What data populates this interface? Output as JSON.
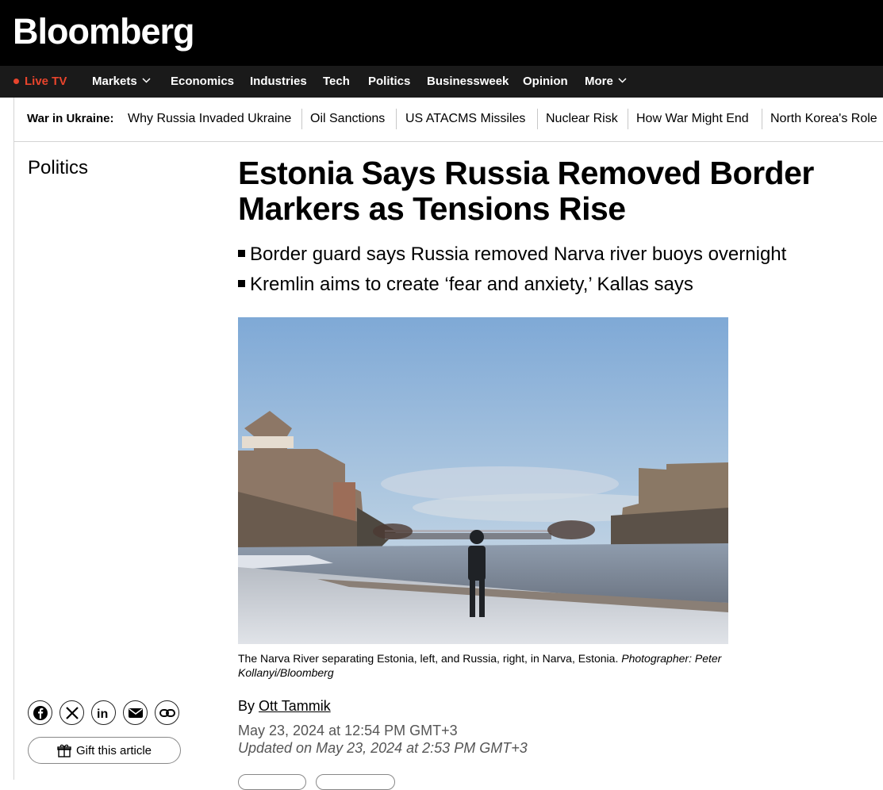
{
  "header": {
    "logo": "Bloomberg"
  },
  "nav": {
    "live": "Live TV",
    "items": [
      {
        "label": "Markets",
        "has_dropdown": true
      },
      {
        "label": "Economics"
      },
      {
        "label": "Industries"
      },
      {
        "label": "Tech"
      },
      {
        "label": "Politics"
      },
      {
        "label": "Businessweek"
      },
      {
        "label": "Opinion"
      },
      {
        "label": "More",
        "has_dropdown": true
      }
    ]
  },
  "topics": {
    "label": "War in Ukraine:",
    "links": [
      "Why Russia Invaded Ukraine",
      "Oil Sanctions",
      "US ATACMS Missiles",
      "Nuclear Risk",
      "How War Might End",
      "North Korea's Role"
    ]
  },
  "article": {
    "section": "Politics",
    "headline": "Estonia Says Russia Removed Border Markers as Tensions Rise",
    "bullets": [
      "Border guard says Russia removed Narva river buoys overnight",
      "Kremlin aims to create ‘fear and anxiety,’ Kallas says"
    ],
    "caption": {
      "text": "The Narva River separating Estonia, left, and Russia, right, in Narva, Estonia. ",
      "credit": "Photographer: Peter Kollanyi/Bloomberg"
    },
    "byline_prefix": "By ",
    "author": "Ott Tammik",
    "date": "May 23, 2024 at 12:54 PM GMT+3",
    "updated": "Updated on May 23, 2024 at 2:53 PM GMT+3"
  },
  "share": {
    "icons": [
      "facebook-icon",
      "x-icon",
      "linkedin-icon",
      "email-icon",
      "link-icon"
    ],
    "gift_label": "Gift this article"
  },
  "colors": {
    "live_red": "#e8442c",
    "nav_bg": "#1a1a1a",
    "header_bg": "#000000"
  }
}
